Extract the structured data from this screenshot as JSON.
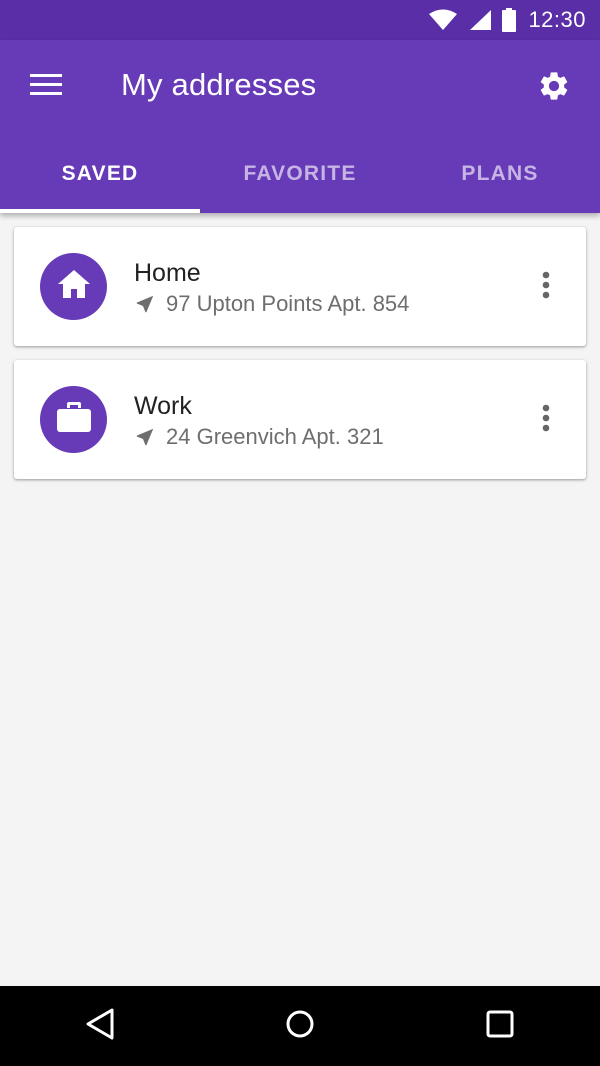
{
  "status_bar": {
    "time": "12:30",
    "icons": [
      "wifi-icon",
      "signal-icon",
      "battery-icon"
    ]
  },
  "toolbar": {
    "title": "My addresses",
    "menu_icon": "hamburger-menu-icon",
    "settings_icon": "gear-icon"
  },
  "tabs": [
    {
      "label": "SAVED",
      "active": true
    },
    {
      "label": "FAVORITE",
      "active": false
    },
    {
      "label": "PLANS",
      "active": false
    }
  ],
  "addresses": [
    {
      "title": "Home",
      "address": "97 Upton Points Apt. 854",
      "icon": "home-icon"
    },
    {
      "title": "Work",
      "address": "24 Greenvich Apt. 321",
      "icon": "briefcase-icon"
    }
  ],
  "nav_bar": {
    "icons": [
      "back-icon",
      "home-circle-icon",
      "recents-icon"
    ]
  },
  "colors": {
    "primary": "#673ab7",
    "primary_dark": "#5a2ea6",
    "background": "#f4f4f4",
    "card": "#ffffff",
    "title_text": "#212121",
    "secondary_text": "#6e6e6e"
  }
}
